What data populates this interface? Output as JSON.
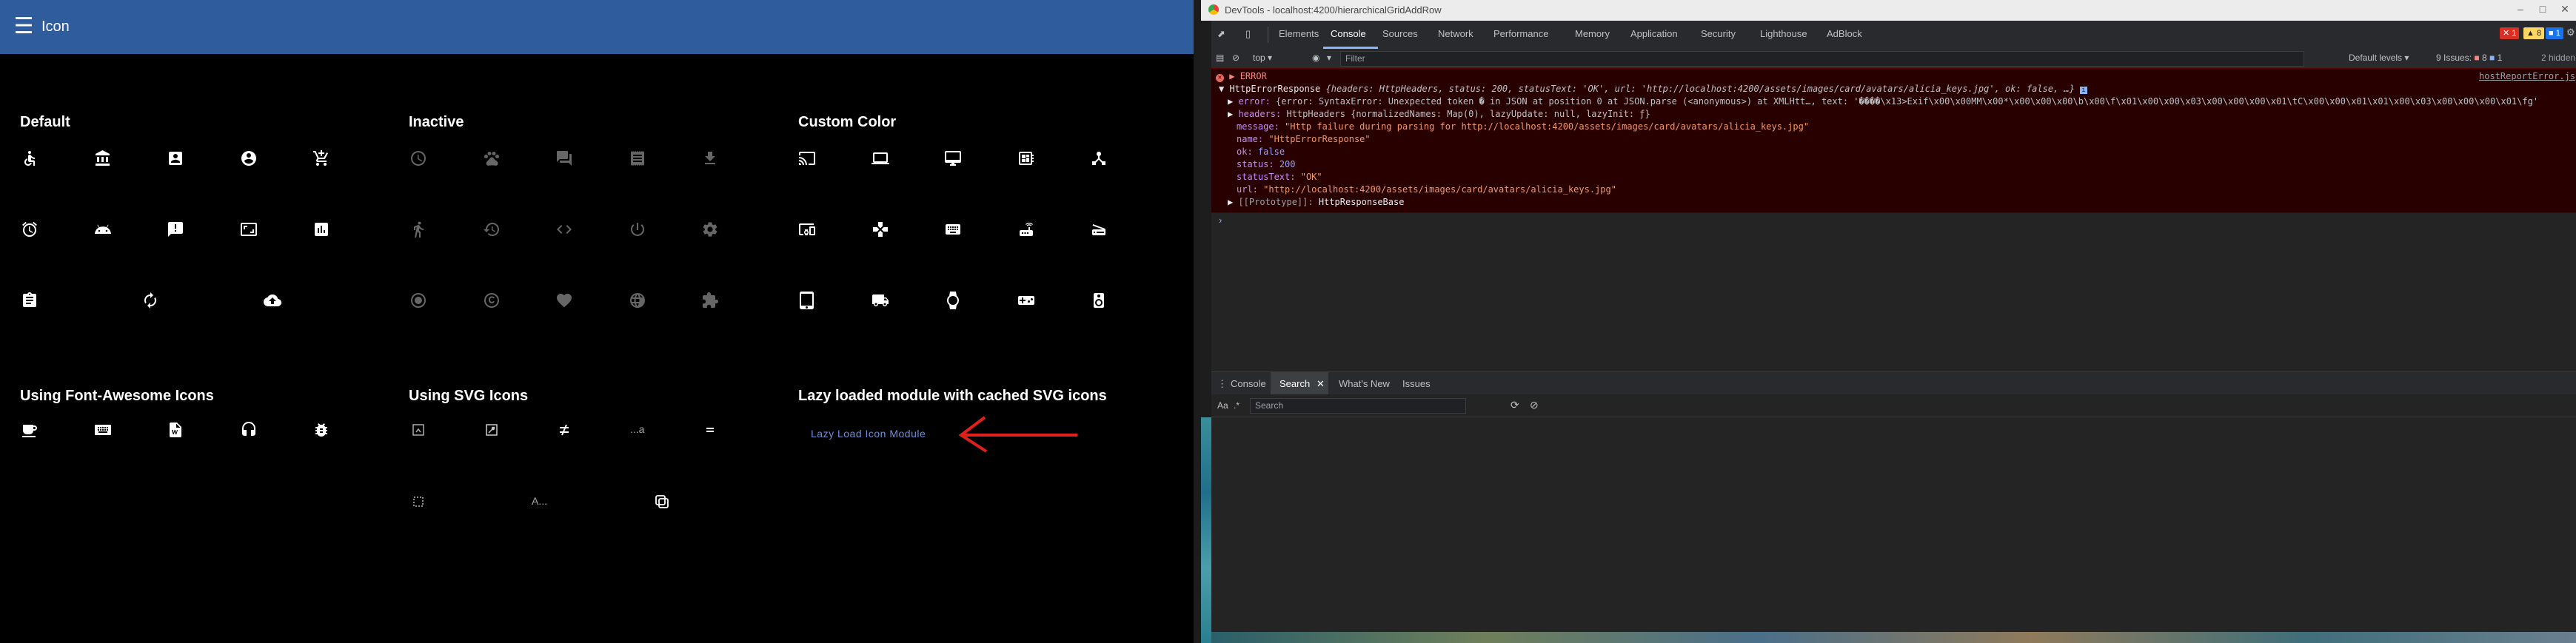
{
  "app": {
    "title": "Icon",
    "menu_icon": "menu-icon",
    "sections": {
      "default": "Default",
      "inactive": "Inactive",
      "custom": "Custom Color",
      "font_awesome": "Using Font-Awesome Icons",
      "svg": "Using SVG Icons",
      "lazy": "Lazy loaded module with cached SVG icons"
    },
    "svg_text_icons": [
      "...a",
      "A..."
    ],
    "lazy_link": "Lazy Load Icon Module",
    "colors": {
      "toolbar": "#2f5c9c",
      "link": "#6d8fd9",
      "arrow": "#e0201c"
    }
  },
  "devtools": {
    "window_title": "DevTools - localhost:4200/hierarchicalGridAddRow",
    "tabs": [
      "Elements",
      "Console",
      "Sources",
      "Network",
      "Performance",
      "Memory",
      "Application",
      "Security",
      "Lighthouse",
      "AdBlock"
    ],
    "badges": {
      "errors": "1",
      "warnings": "8",
      "info": "1"
    },
    "context": "top",
    "filter_placeholder": "Filter",
    "levels": "Default levels",
    "issues": "9 Issues:",
    "issues_err": "8",
    "issues_info": "1",
    "hidden": "2 hidden",
    "error": {
      "label": "ERROR",
      "source_link": "hostReportError.js",
      "line1_name": "HttpErrorResponse",
      "line1_rest": "{headers: HttpHeaders, status: 200, statusText: 'OK', url: 'http://localhost:4200/assets/images/card/avatars/alicia_keys.jpg', ok: false, …}",
      "line2_key": "error:",
      "line2_rest": "{error: SyntaxError: Unexpected token � in JSON at position 0 at JSON.parse (<anonymous>) at XMLHtt…, text: '����\\x13>Exif\\x00\\x00MM\\x00*\\x00\\x00\\x00\\b\\x00\\f\\x01\\x00\\x00\\x03\\x00\\x00\\x00\\x01\\tC\\x00\\x00\\x01\\x01\\x00\\x03\\x00\\x00\\x00\\x01\\fg'",
      "line3_key": "headers:",
      "line3_rest": "HttpHeaders {normalizedNames: Map(0), lazyUpdate: null, lazyInit: ƒ}",
      "message_key": "message:",
      "message_val": "\"Http failure during parsing for http://localhost:4200/assets/images/card/avatars/alicia_keys.jpg\"",
      "name_key": "name:",
      "name_val": "\"HttpErrorResponse\"",
      "ok_key": "ok:",
      "ok_val": "false",
      "status_key": "status:",
      "status_val": "200",
      "statustext_key": "statusText:",
      "statustext_val": "\"OK\"",
      "url_key": "url:",
      "url_val": "\"http://localhost:4200/assets/images/card/avatars/alicia_keys.jpg\"",
      "proto_key": "[[Prototype]]:",
      "proto_val": "HttpResponseBase"
    },
    "drawer_tabs": [
      "Console",
      "Search",
      "What's New",
      "Issues"
    ],
    "search_placeholder": "Search",
    "aa": "Aa",
    "regex": ".*"
  }
}
